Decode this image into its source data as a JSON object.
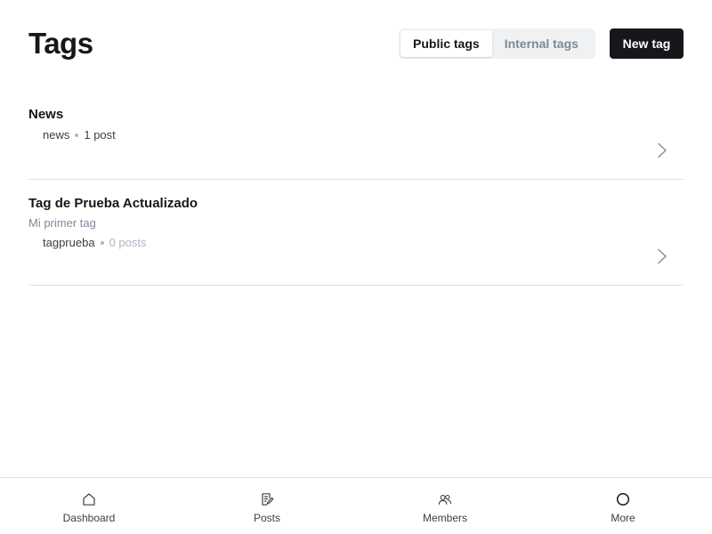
{
  "header": {
    "title": "Tags",
    "tabs": [
      {
        "label": "Public tags",
        "active": true
      },
      {
        "label": "Internal tags",
        "active": false
      }
    ],
    "new_tag_label": "New tag"
  },
  "tags": [
    {
      "name": "News",
      "description": "",
      "slug": "news",
      "count": "1 post"
    },
    {
      "name": "Tag de Prueba Actualizado",
      "description": "Mi primer tag",
      "slug": "tagprueba",
      "count": "0 posts"
    }
  ],
  "nav": [
    {
      "label": "Dashboard",
      "icon": "home-icon"
    },
    {
      "label": "Posts",
      "icon": "posts-icon"
    },
    {
      "label": "Members",
      "icon": "members-icon"
    },
    {
      "label": "More",
      "icon": "more-circle-icon"
    }
  ],
  "colors": {
    "primary": "#15171a",
    "muted": "#7c8b9a",
    "border": "#dcdfe2",
    "segment_bg": "#eff1f2"
  }
}
